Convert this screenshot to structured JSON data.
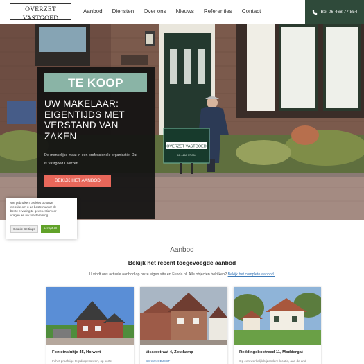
{
  "header": {
    "logo_name": "OVERZET VASTGOED",
    "logo_url": "www.overzetvastgoed.nl",
    "nav": [
      "Aanbod",
      "Diensten",
      "Over ons",
      "Nieuws",
      "Referenties",
      "Contact"
    ],
    "call_label": "Bel 06 468 77 854",
    "accent_color": "#2f4a3a"
  },
  "hero": {
    "badge": "TE KOOP",
    "title": "UW MAKELAAR: EIGENTIJDS MET VERSTAND VAN ZAKEN",
    "text_line1": "De menselijke maat in een professionele organisatie. Dat",
    "text_line2": "is Vastgoed Overzet!",
    "button": "BEKIJK HET AANBOD",
    "sign_text": "OVERZET VASTGOED",
    "sign_phone": "06 - 468 77 854",
    "badge_color": "#8ab4a6",
    "button_color": "#e8675a"
  },
  "cookie": {
    "line1": "We gebruiken cookies op onze",
    "line2": "website om u de beste manier de",
    "line3": "beste ervaring te geven. Hiervoor",
    "line4": "vragen wij uw toestemming.",
    "settings": "Cookie Settings",
    "accept": "Accept All"
  },
  "section": {
    "kicker": "Aanbod",
    "title": "Bekijk het recent toegevoegde aanbod",
    "intro": "U vindt ons actuele aanbod op onze eigen site en Funda.nl. Alle objecten bekijken?",
    "intro_link": "Bekijk het complete aanbod."
  },
  "properties": [
    {
      "title": "Fonteinsluitje 45, Holwert",
      "desc": "In het prachtige terpdorp Holwert, op korte"
    },
    {
      "title": "Visserstraat 4, Zoutkamp",
      "link": "Bekijk object"
    },
    {
      "title": "Reddingsbootreed 11, Moddergat",
      "desc": "Op een werkelijk bijzondere locatie, aan de and"
    }
  ]
}
